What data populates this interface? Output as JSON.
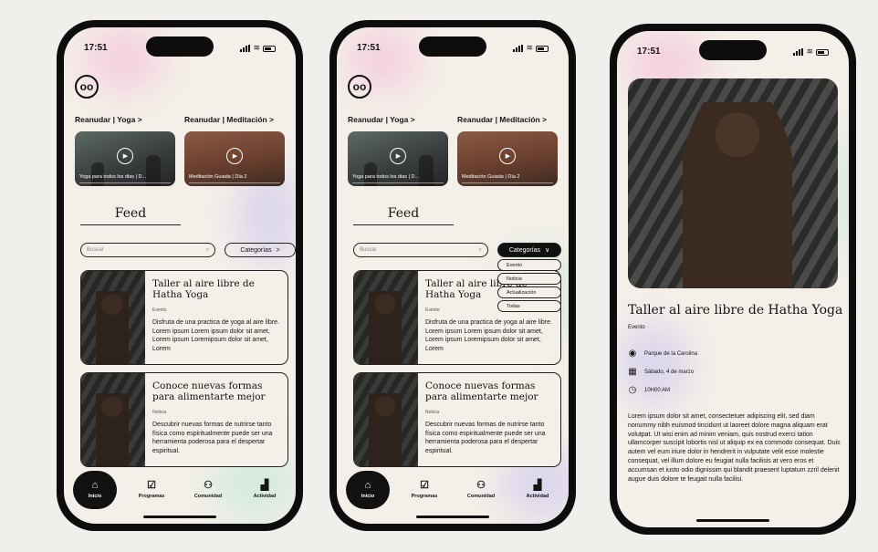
{
  "status_bar": {
    "time": "17:51"
  },
  "logo": {
    "glyph": "oo"
  },
  "home": {
    "resume_yoga": "Reanudar | Yoga >",
    "resume_meditation": "Reanudar | Meditación >",
    "video_yoga_caption": "Yoga para todos los dias | D...",
    "video_meditation_caption": "Meditación Guiada | Día 2",
    "feed_title": "Feed",
    "search_placeholder": "Buscar",
    "categories_label": "Categorías",
    "categories_chevron": ">",
    "categories_chevron_open": "∨",
    "dropdown_options": [
      "Evento",
      "Noticia",
      "Actualización",
      "Todas"
    ],
    "cards": [
      {
        "title": "Taller al aire libre de Hatha Yoga",
        "tag": "Evento",
        "text": "Disfruta de una practica de yoga al aire libre. Lorem ipsum Lorem ipsum dolor sit amet, Lorem ipsum Loremipsum dolor sit amet, Lorem"
      },
      {
        "title": "Conoce nuevas formas para alimentarte mejor",
        "tag": "Noticia",
        "text": "Descubrir nuevas formas de nutrirse tanto física como espiritualmente puede ser una herramienta poderosa para el despertar espiritual."
      }
    ]
  },
  "nav": {
    "items": [
      "Inicio",
      "Programas",
      "Comunidad",
      "Actividad"
    ]
  },
  "detail": {
    "title": "Taller al aire libre de Hatha Yoga",
    "tag": "Evento",
    "location": "Parque de la Carolina",
    "date": "Sábado, 4 de marzo",
    "time": "10H00 AM",
    "body": "Lorem ipsum dolor sit amet, consectetuer adipiscing elit, sed diam nonummy nibh euismod tincidunt ut laoreet dolore magna aliquam erat volutpat. Ut wisi enim ad minim veniam, quis nostrud exerci tation ullamcorper suscipit lobortis nisl ut aliquip ex ea commodo consequat. Duis autem vel eum iriure dolor in hendrerit in vulputate velit esse molestie consequat, vel illum dolore eu feugiat nulla facilisis at vero eros et accumsan et iusto odio dignissim qui blandit praesent luptatum zzril delenit augue duis dolore te feugait nulla facilisi."
  },
  "icons": {
    "play": "play-icon",
    "search": "search-icon",
    "home": "home-icon",
    "programs": "programs-icon",
    "community": "community-icon",
    "activity": "activity-icon",
    "location": "location-pin-icon",
    "calendar": "calendar-icon",
    "clock": "clock-icon"
  },
  "colors": {
    "background": "#f1efeb",
    "screen": "#f4efe9",
    "ink": "#141414",
    "pink_glow": "#f6b8d6",
    "mint_glow": "#bfe8d8",
    "lilac_glow": "#c9c2f0"
  }
}
